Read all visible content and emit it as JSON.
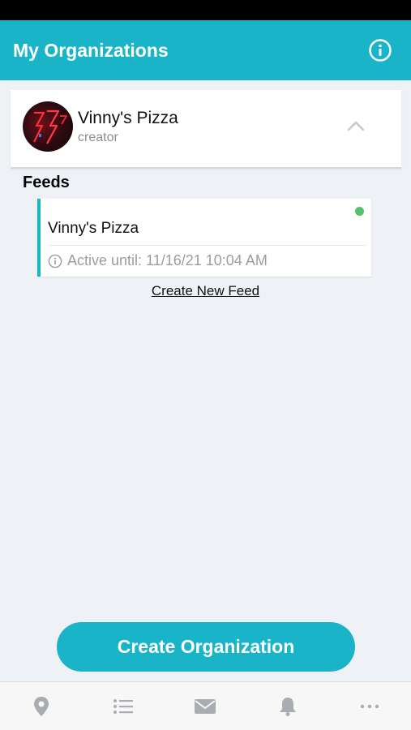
{
  "header": {
    "title": "My Organizations",
    "info_icon": "info-icon"
  },
  "organization": {
    "name": "Vinny's Pizza",
    "role": "creator",
    "expanded": true,
    "avatar": "neon-sign-avatar"
  },
  "feeds": {
    "heading": "Feeds",
    "items": [
      {
        "name": "Vinny's Pizza",
        "status_prefix": "Active until: 11/16/21 10:04 AM",
        "active": true
      }
    ],
    "create_link": "Create New Feed"
  },
  "actions": {
    "create_org": "Create Organization"
  },
  "tab_bar": {
    "tabs": [
      {
        "icon": "map-pin-icon"
      },
      {
        "icon": "list-icon"
      },
      {
        "icon": "mail-icon"
      },
      {
        "icon": "bell-icon"
      },
      {
        "icon": "more-icon"
      }
    ]
  },
  "colors": {
    "accent": "#19b4c8",
    "active_dot": "#55c16c",
    "background": "#eef1f6"
  }
}
